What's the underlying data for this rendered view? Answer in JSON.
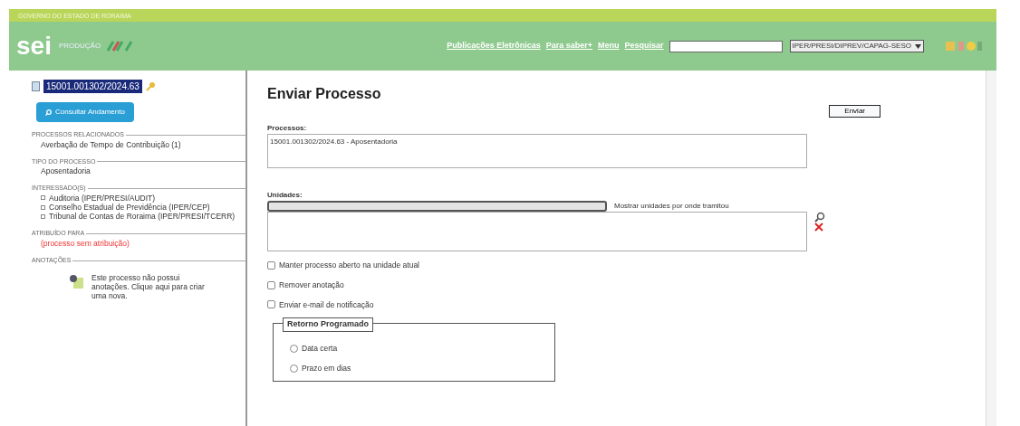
{
  "header": {
    "government": "GOVERNO DO ESTADO DE RORAIMA",
    "logo": "sei",
    "environment": "PRODUÇÃO",
    "menu": [
      {
        "label": "Publicações Eletrônicas"
      },
      {
        "label": "Para saber+"
      },
      {
        "label": "Menu"
      },
      {
        "label": "Pesquisar"
      }
    ],
    "unit_select": "IPER/PRESI/DIPREV/CAPAG-SESO"
  },
  "sidebar": {
    "process_number": "15001.001302/2024.63",
    "consult_button": "Consultar Andamento",
    "sections": [
      {
        "title": "PROCESSOS RELACIONADOS",
        "items": [
          "Averbação de Tempo de Contribuição (1)"
        ]
      },
      {
        "title": "TIPO DO PROCESSO",
        "items": [
          "Aposentadoria"
        ]
      },
      {
        "title": "INTERESSADO(S)",
        "items": [
          "Auditoria (IPER/PRESI/AUDIT)",
          "Conselho Estadual de Previdência (IPER/CEP)",
          "Tribunal de Contas de Roraima (IPER/PRESI/TCERR)"
        ],
        "bulleted": true
      },
      {
        "title": "ATRIBUÍDO PARA",
        "items": [
          "(processo sem atribuição)"
        ],
        "warning": true
      }
    ],
    "notes": {
      "title": "ANOTAÇÕES",
      "text_before": "Este processo não possui anotações.",
      "link": "Clique aqui",
      "text_after": "para criar uma nova."
    }
  },
  "form": {
    "title": "Enviar Processo",
    "send_button": "Enviar",
    "processes_label": "Processos:",
    "processes": [
      "15001.001302/2024.63 - Aposentadoria"
    ],
    "units_label": "Unidades:",
    "show_units_link": "Mostrar unidades por onde tramitou",
    "options": [
      {
        "label": "Manter processo aberto na unidade atual",
        "checked": false
      },
      {
        "label": "Remover anotação",
        "checked": false
      },
      {
        "label": "Enviar e-mail de notificação",
        "checked": false
      }
    ],
    "return": {
      "legend": "Retorno Programado",
      "choices": [
        {
          "label": "Data certa",
          "selected": false
        },
        {
          "label": "Prazo em dias",
          "selected": false
        }
      ]
    }
  }
}
